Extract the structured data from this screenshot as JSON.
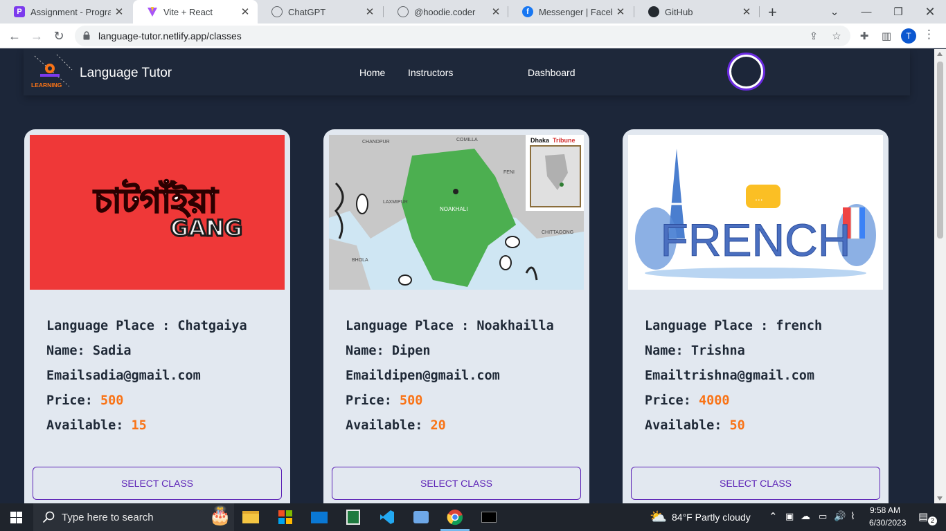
{
  "browser": {
    "tabs": [
      {
        "title": "Assignment - Program",
        "icon": "assignment-favicon",
        "color": "#7c3aed"
      },
      {
        "title": "Vite + React",
        "icon": "vite-favicon",
        "color": "#a855f7",
        "active": true
      },
      {
        "title": "ChatGPT",
        "icon": "chatgpt-favicon",
        "color": "#5f6368"
      },
      {
        "title": "@hoodie.coder",
        "icon": "globe-favicon",
        "color": "#5f6368"
      },
      {
        "title": "Messenger | Facebook",
        "icon": "facebook-favicon",
        "color": "#1877f2"
      },
      {
        "title": "GitHub",
        "icon": "github-favicon",
        "color": "#24292f"
      }
    ],
    "url": "language-tutor.netlify.app/classes",
    "profile_initial": "T"
  },
  "site": {
    "brand": "Language Tutor",
    "logo_text": "LEARNING",
    "nav": {
      "home": "Home",
      "instructors": "Instructors",
      "dashboard": "Dashboard"
    }
  },
  "labels": {
    "place": "Language Place : ",
    "name": "Name: ",
    "email": "Email",
    "price": "Price: ",
    "available": "Available: "
  },
  "classes": [
    {
      "place": "Chatgaiya",
      "name": "Sadia",
      "email": "sadia@gmail.com",
      "price": "500",
      "available": "15",
      "button": "SELECT CLASS",
      "image_text": [
        "চাটগাঁইয়া",
        "GANG"
      ]
    },
    {
      "place": "Noakhailla",
      "name": "Dipen",
      "email": "dipen@gmail.com",
      "price": "500",
      "available": "20",
      "button": "SELECT CLASS",
      "image_text": [
        "CHANDPUR",
        "COMILLA",
        "FENI",
        "LAXMIPUR",
        "NOAKHALI",
        "CHITTAGONG",
        "BHOLA",
        "Dhaka",
        "Tribune"
      ]
    },
    {
      "place": "french",
      "name": "Trishna",
      "email": "trishna@gmail.com",
      "price": "4000",
      "available": "50",
      "button": "SELECT CLASS",
      "image_text": [
        "FRENCH"
      ]
    }
  ],
  "taskbar": {
    "search_placeholder": "Type here to search",
    "weather": "84°F  Partly cloudy",
    "time": "9:58 AM",
    "date": "6/30/2023",
    "notification_count": "2"
  },
  "colors": {
    "accent": "#5b21b6",
    "highlight": "#f97316",
    "page_bg": "#1c2639",
    "card_bg": "#e2e8f0"
  }
}
